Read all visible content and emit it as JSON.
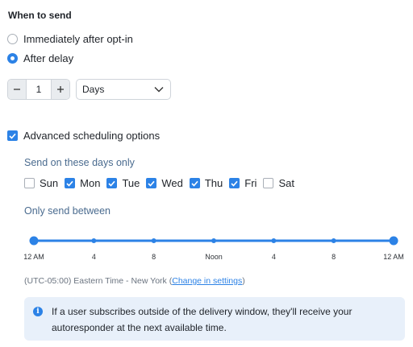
{
  "when_to_send": {
    "title": "When to send",
    "options": [
      {
        "label": "Immediately after opt-in",
        "selected": false
      },
      {
        "label": "After delay",
        "selected": true
      }
    ]
  },
  "delay": {
    "value": "1",
    "decrement_icon": "minus-icon",
    "increment_icon": "plus-icon",
    "unit_selected": "Days",
    "unit_icon": "chevron-down-icon"
  },
  "advanced": {
    "label": "Advanced scheduling options",
    "checked": true
  },
  "days_section": {
    "title": "Send on these days only",
    "days": [
      {
        "label": "Sun",
        "checked": false
      },
      {
        "label": "Mon",
        "checked": true
      },
      {
        "label": "Tue",
        "checked": true
      },
      {
        "label": "Wed",
        "checked": true
      },
      {
        "label": "Thu",
        "checked": true
      },
      {
        "label": "Fri",
        "checked": true
      },
      {
        "label": "Sat",
        "checked": false
      }
    ]
  },
  "time_window": {
    "title": "Only send between",
    "tick_labels": [
      "12 AM",
      "4",
      "8",
      "Noon",
      "4",
      "8",
      "12 AM"
    ],
    "range_start_fraction": 0,
    "range_end_fraction": 1
  },
  "timezone": {
    "text": "(UTC-05:00) Eastern Time - New York (",
    "link": "Change in settings",
    "suffix": ")"
  },
  "info_box": {
    "icon": "info-icon",
    "text": "If a user subscribes outside of the delivery window, they'll receive your autoresponder at the next available time."
  },
  "colors": {
    "accent": "#2c82e6",
    "info_background": "#e8f0fa",
    "subtitle": "#4a6b8f"
  }
}
